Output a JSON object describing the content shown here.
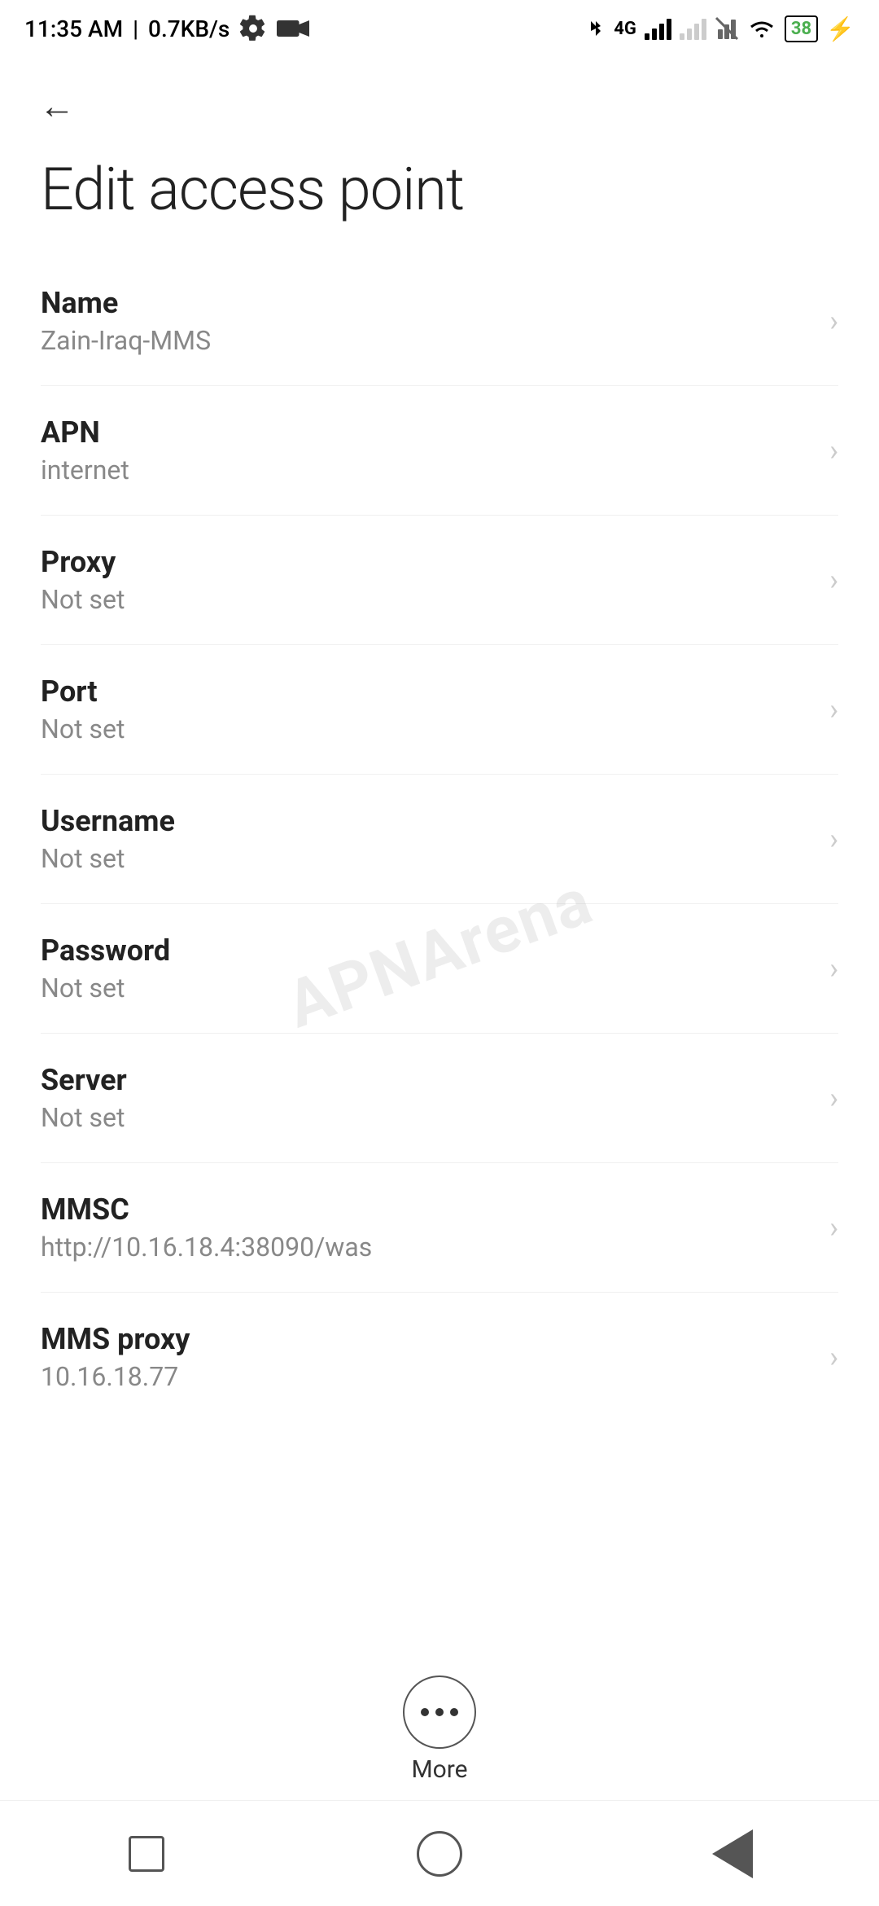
{
  "statusBar": {
    "time": "11:35 AM",
    "speed": "0.7KB/s",
    "battery": "38"
  },
  "nav": {
    "backLabel": "←"
  },
  "page": {
    "title": "Edit access point"
  },
  "settings": [
    {
      "label": "Name",
      "value": "Zain-Iraq-MMS"
    },
    {
      "label": "APN",
      "value": "internet"
    },
    {
      "label": "Proxy",
      "value": "Not set"
    },
    {
      "label": "Port",
      "value": "Not set"
    },
    {
      "label": "Username",
      "value": "Not set"
    },
    {
      "label": "Password",
      "value": "Not set"
    },
    {
      "label": "Server",
      "value": "Not set"
    },
    {
      "label": "MMSC",
      "value": "http://10.16.18.4:38090/was"
    },
    {
      "label": "MMS proxy",
      "value": "10.16.18.77"
    }
  ],
  "watermark": "APNArena",
  "more": {
    "label": "More"
  }
}
